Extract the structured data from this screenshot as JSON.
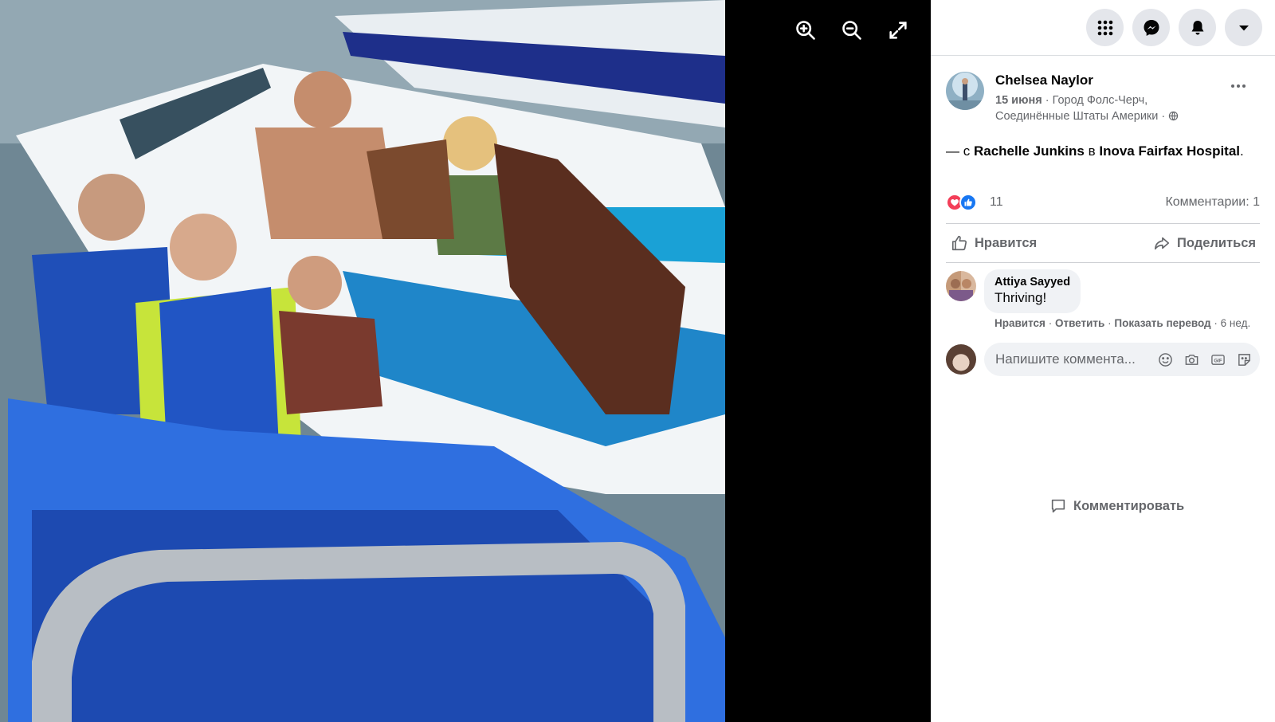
{
  "viewer": {
    "photo_alt": "Group photo on a jet ski and boat with two dogs",
    "tools": [
      {
        "name": "zoom-in-icon"
      },
      {
        "name": "zoom-out-icon"
      },
      {
        "name": "fullscreen-icon"
      }
    ]
  },
  "topbar": {
    "buttons": [
      "menu-grid-icon",
      "messenger-icon",
      "notifications-bell-icon",
      "account-caret-icon"
    ]
  },
  "post": {
    "author": "Chelsea Naylor",
    "date": "15 июня",
    "location": "Город Фолс-Черч, Соединённые Штаты Америки",
    "separator": "·",
    "caption": {
      "prefix": "— с",
      "tagged": "Rachelle Junkins",
      "middle": "в",
      "place": "Inova Fairfax Hospital",
      "suffix": "."
    },
    "reactions_count": "11",
    "comments_count": "Комментарии: 1",
    "actions": {
      "like": "Нравится",
      "comment": "Комментировать",
      "share": "Поделиться"
    }
  },
  "comments": [
    {
      "author": "Attiya Sayyed",
      "text": "Thriving!",
      "like": "Нравится",
      "reply": "Ответить",
      "translate": "Показать перевод",
      "time": "6 нед."
    }
  ],
  "composer": {
    "placeholder": "Напишите коммента..."
  },
  "colors": {
    "like_blue": "#1877f2",
    "love_red": "#f33e58",
    "muted_text": "#65676b",
    "bubble_bg": "#f0f2f5"
  }
}
